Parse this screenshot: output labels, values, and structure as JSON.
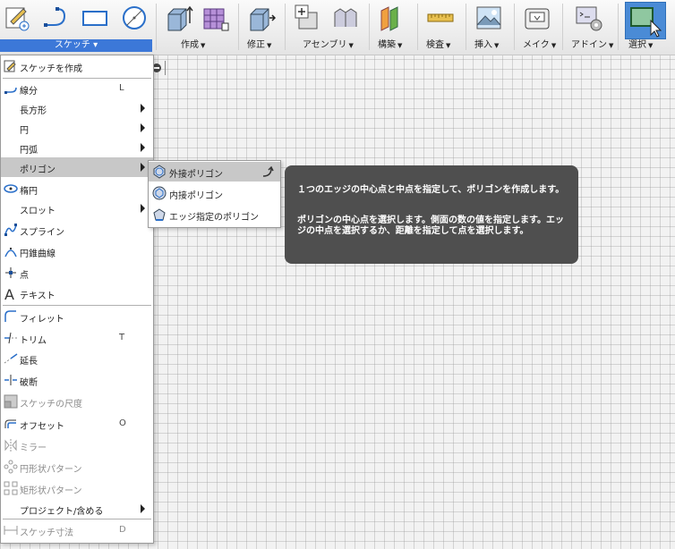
{
  "toolbar": {
    "sketch_label": "スケッチ ▾",
    "groups": [
      {
        "label": "作成"
      },
      {
        "label": "修正"
      },
      {
        "label": "アセンブリ"
      },
      {
        "label": "構築"
      },
      {
        "label": "検査"
      },
      {
        "label": "挿入"
      },
      {
        "label": "メイク"
      },
      {
        "label": "アドイン"
      },
      {
        "label": "選択"
      }
    ]
  },
  "menu": {
    "items": [
      {
        "label": "スケッチを作成",
        "shortcut": ""
      },
      {
        "label": "線分",
        "shortcut": "L"
      },
      {
        "label": "長方形",
        "shortcut": ""
      },
      {
        "label": "円",
        "shortcut": ""
      },
      {
        "label": "円弧",
        "shortcut": ""
      },
      {
        "label": "ポリゴン",
        "shortcut": ""
      },
      {
        "label": "楕円",
        "shortcut": ""
      },
      {
        "label": "スロット",
        "shortcut": ""
      },
      {
        "label": "スプライン",
        "shortcut": ""
      },
      {
        "label": "円錐曲線",
        "shortcut": ""
      },
      {
        "label": "点",
        "shortcut": ""
      },
      {
        "label": "テキスト",
        "shortcut": ""
      },
      {
        "label": "フィレット",
        "shortcut": ""
      },
      {
        "label": "トリム",
        "shortcut": "T"
      },
      {
        "label": "延長",
        "shortcut": ""
      },
      {
        "label": "破断",
        "shortcut": ""
      },
      {
        "label": "スケッチの尺度",
        "shortcut": ""
      },
      {
        "label": "オフセット",
        "shortcut": "O"
      },
      {
        "label": "ミラー",
        "shortcut": ""
      },
      {
        "label": "円形状パターン",
        "shortcut": ""
      },
      {
        "label": "矩形状パターン",
        "shortcut": ""
      },
      {
        "label": "プロジェクト/含める",
        "shortcut": ""
      },
      {
        "label": "スケッチ寸法",
        "shortcut": "D"
      }
    ]
  },
  "submenu": {
    "items": [
      {
        "label": "外接ポリゴン"
      },
      {
        "label": "内接ポリゴン"
      },
      {
        "label": "エッジ指定のポリゴン"
      }
    ]
  },
  "tooltip": {
    "line1": "１つのエッジの中心点と中点を指定して、ポリゴンを作成します。",
    "line2": "ポリゴンの中心点を選択します。側面の数の値を指定します。エッジの中点を選択するか、距離を指定して点を選択します。"
  },
  "colors": {
    "accent": "#3c78d8",
    "tooltip_bg": "#4f4f4f",
    "highlight": "#c8c8c8"
  }
}
